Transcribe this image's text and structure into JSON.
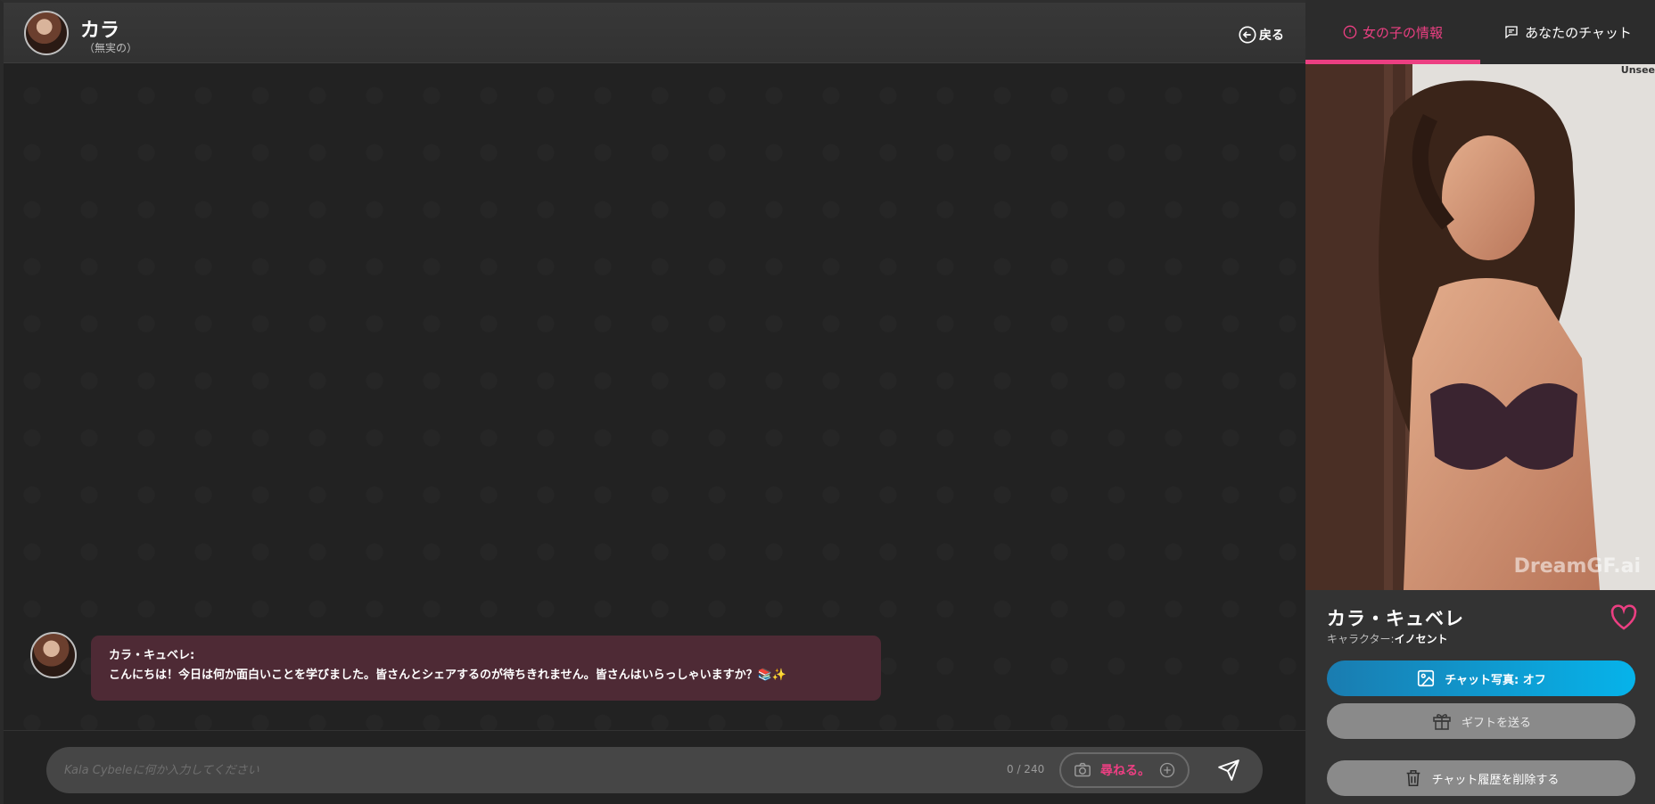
{
  "header": {
    "name": "カラ",
    "subtitle": "（無実の）",
    "back_label": "戻る"
  },
  "messages": [
    {
      "sender": "カラ・キュベレ:",
      "text": "こんにちは！今日は何か面白いことを学びました。皆さんとシェアするのが待ちきれません。皆さんはいらっしゃいますか？📚✨"
    }
  ],
  "composer": {
    "placeholder": "Kala Cybeleに何か入力してください",
    "char_count": "0 / 240",
    "ask_label": "尋ねる。"
  },
  "panel": {
    "tabs": [
      {
        "label": "女の子の情報",
        "active": true
      },
      {
        "label": "あなたのチャット",
        "active": false
      }
    ],
    "photo_watermark": "DreamGF.ai",
    "corner_mark": "Unsee",
    "name": "カラ・キュベレ",
    "character_label": "キャラクター:",
    "character_value": "イノセント",
    "photo_toggle_label": "チャット写真:  オフ",
    "gift_label": "ギフトを送る",
    "delete_label": "チャット履歴を削除する"
  },
  "colors": {
    "accent": "#ec3f82",
    "bubble": "#4e2a35",
    "toggle_from": "#1a7cb0",
    "toggle_to": "#06b3ea"
  },
  "icons": [
    "back-arrow-icon",
    "info-icon",
    "chat-icon",
    "camera-icon",
    "plus-icon",
    "send-icon",
    "heart-icon",
    "image-icon",
    "gift-icon",
    "trash-icon"
  ]
}
